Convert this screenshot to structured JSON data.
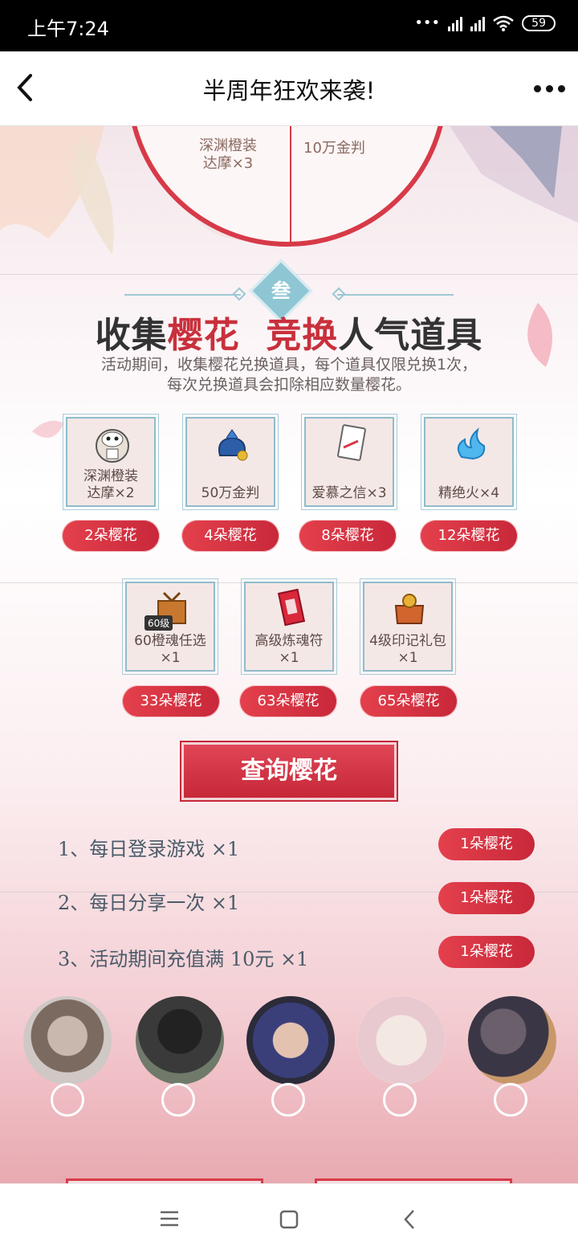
{
  "status_bar": {
    "time": "上午7:24",
    "battery": "59"
  },
  "nav": {
    "title": "半周年狂欢来袭!"
  },
  "wheel": {
    "labels": [
      "深渊橙装\n达摩×3",
      "10万金判"
    ]
  },
  "section": {
    "badge": "叁",
    "heading_part1": "收集",
    "heading_part2": "樱花",
    "heading_part3": "竞换",
    "heading_part4": "人气道具",
    "desc_line1": "活动期间，收集樱花兑换道具，每个道具仅限兑换1次，",
    "desc_line2": "每次兑换道具会扣除相应数量樱花。"
  },
  "items_row1": [
    {
      "name": "深渊橙装\n达摩×2",
      "price": "2朵樱花"
    },
    {
      "name": "50万金判",
      "price": "4朵樱花"
    },
    {
      "name": "爱慕之信×3",
      "price": "8朵樱花"
    },
    {
      "name": "精绝火×4",
      "price": "12朵樱花"
    }
  ],
  "items_row2": [
    {
      "name": "60橙魂任选\n×1",
      "price": "33朵樱花",
      "tag": "60级"
    },
    {
      "name": "高级炼魂符\n×1",
      "price": "63朵樱花"
    },
    {
      "name": "4级印记礼包\n×1",
      "price": "65朵樱花"
    }
  ],
  "query_button": "查询樱花",
  "tasks": [
    {
      "text": "1、每日登录游戏 ×1",
      "reward": "1朵樱花"
    },
    {
      "text": "2、每日分享一次 ×1",
      "reward": "1朵樱花"
    },
    {
      "text": "3、活动期间充值满 10元 ×1",
      "reward": "1朵樱花"
    }
  ],
  "colors": {
    "accent": "#d73a48",
    "teal": "#8fbccb"
  }
}
